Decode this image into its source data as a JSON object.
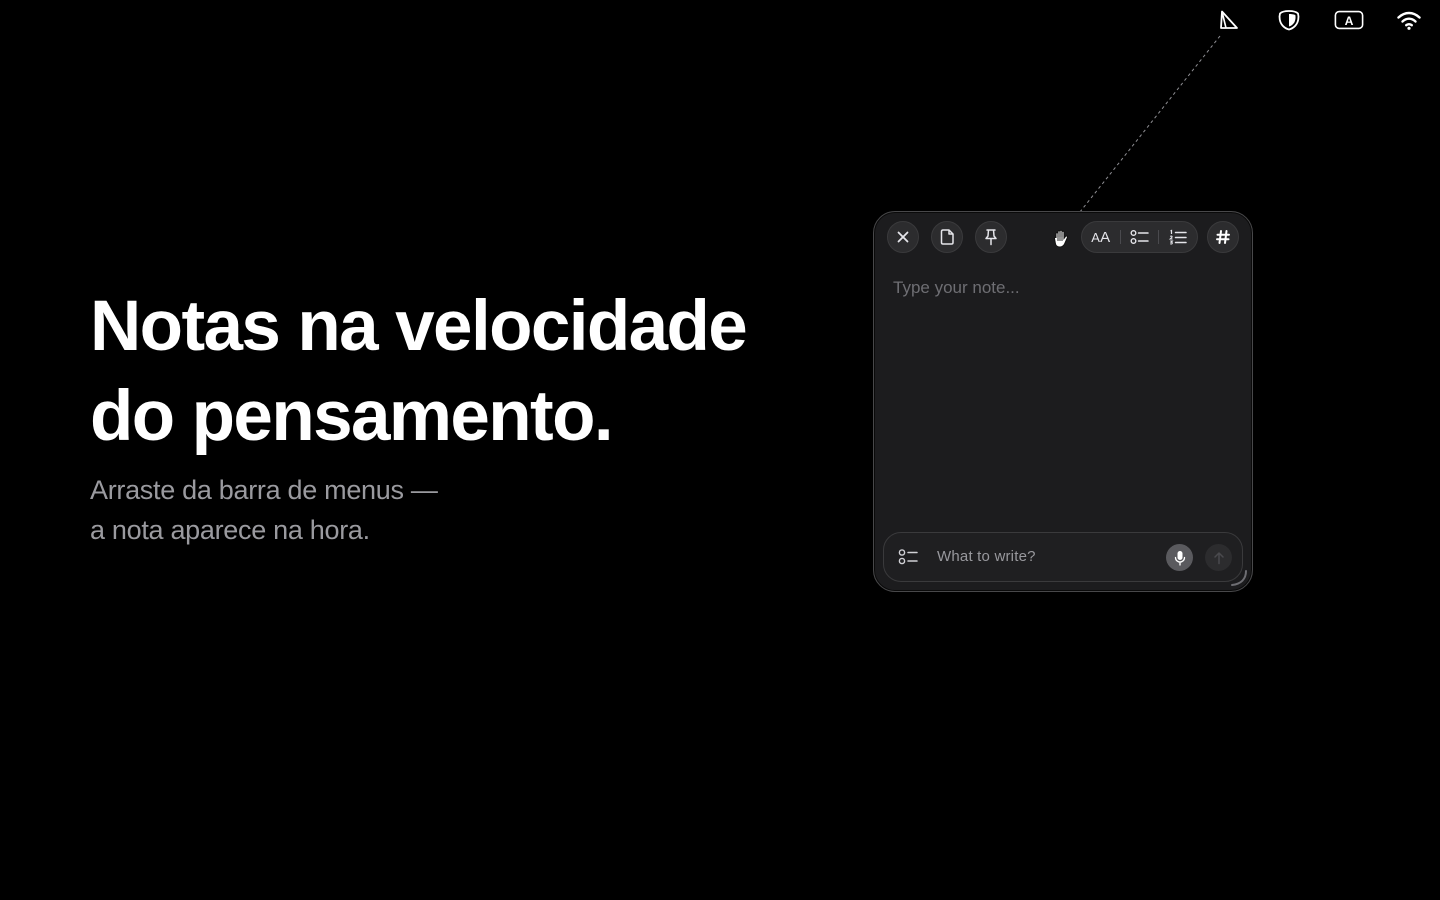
{
  "hero": {
    "title_line1": "Notas na velocidade",
    "title_line2": "do pensamento.",
    "subtitle_line1": "Arraste da barra de menus —",
    "subtitle_line2": "a nota aparece na hora."
  },
  "menubar": {
    "icons": [
      "notes-app-icon",
      "shield-icon",
      "input-source-icon",
      "wifi-icon"
    ],
    "input_source_label": "A"
  },
  "note_window": {
    "toolbar": {
      "close_icon": "close-icon",
      "doc_icon": "document-icon",
      "pin_icon": "pin-icon",
      "drag_icon": "hand-icon",
      "text_size_label_small": "A",
      "text_size_label_big": "A",
      "checklist_icon": "checklist-icon",
      "numbered_list_icon": "numbered-list-icon",
      "tag_label": "#"
    },
    "body_placeholder": "Type your note...",
    "composer": {
      "placeholder": "What to write?",
      "mic_icon": "microphone-icon",
      "send_icon": "arrow-up-icon"
    }
  },
  "colors": {
    "background": "#000000",
    "window_bg": "#1c1c1e",
    "subtitle": "#9a9a9f",
    "placeholder": "#6e6e73"
  }
}
